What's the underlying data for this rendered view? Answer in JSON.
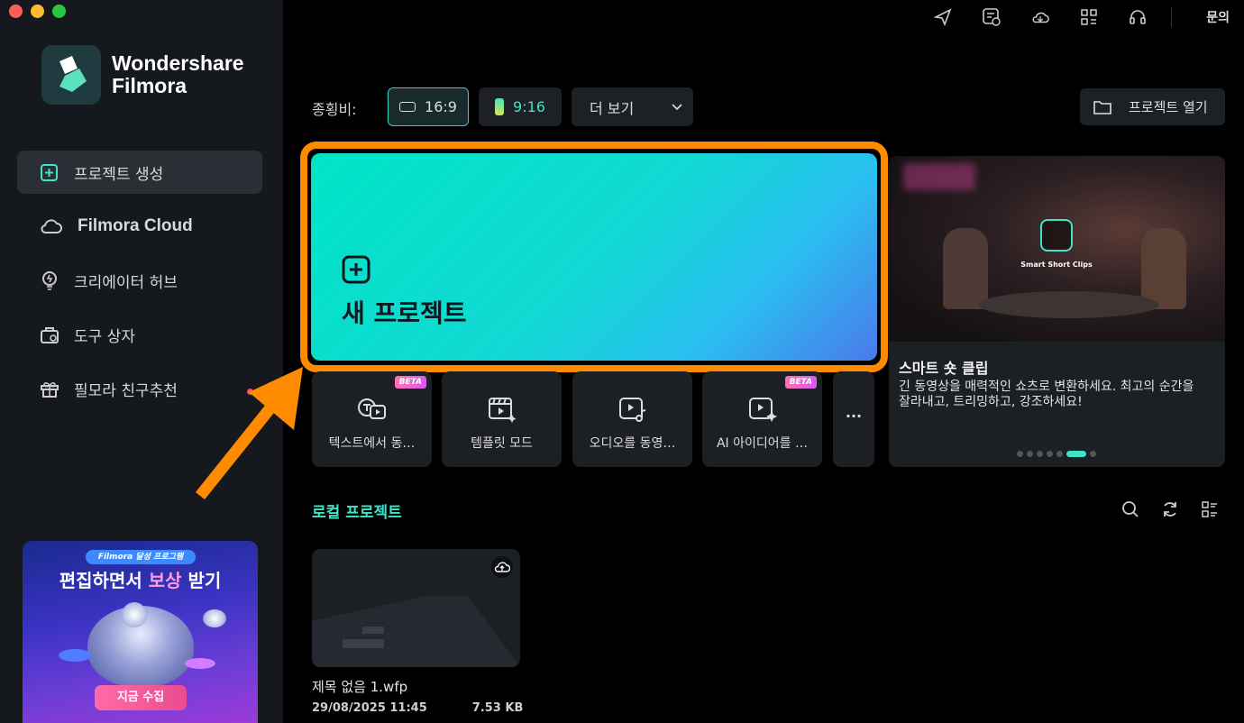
{
  "app": {
    "brand_line1": "Wondershare",
    "brand_line2": "Filmora"
  },
  "colors": {
    "accent": "#3fe3c9",
    "highlight_arrow": "#ff8c00",
    "bg": "#000000",
    "sidebar": "#15181c"
  },
  "sidebar": {
    "items": [
      {
        "label": "프로젝트 생성",
        "icon": "new-project-icon",
        "active": true
      },
      {
        "label": "Filmora Cloud",
        "icon": "cloud-icon"
      },
      {
        "label": "크리에이터 허브",
        "icon": "lightbulb-icon"
      },
      {
        "label": "도구 상자",
        "icon": "toolbox-icon"
      },
      {
        "label": "필모라 친구추천",
        "icon": "gift-icon",
        "badge_dot": true
      }
    ],
    "promo": {
      "tag": "Filmora 달성 프로그램",
      "title_before": "편집하면서 ",
      "title_highlight": "보상",
      "title_after": " 받기",
      "button": "지금 수집"
    }
  },
  "topbar": {
    "icons": [
      "send-icon",
      "schedule-icon",
      "cloud-sync-icon",
      "grid-icon",
      "headset-icon"
    ],
    "help_label": "문의"
  },
  "aspect": {
    "label": "종횡비:",
    "options": [
      {
        "label": "16:9",
        "selected": true
      },
      {
        "label": "9:16"
      },
      {
        "label": "더 보기"
      }
    ],
    "open_project": "프로젝트 열기"
  },
  "new_project": {
    "label": "새 프로젝트"
  },
  "tools": [
    {
      "label": "텍스트에서 동…",
      "beta": "BETA",
      "icon": "text-to-video-icon"
    },
    {
      "label": "템플릿 모드",
      "icon": "template-icon"
    },
    {
      "label": "오디오를 동영…",
      "icon": "audio-to-video-icon"
    },
    {
      "label": "AI 아이디어를 …",
      "beta": "BETA",
      "icon": "ai-idea-icon"
    },
    {
      "label": "···",
      "icon": "more-icon"
    }
  ],
  "carousel": {
    "overlay_label": "Smart Short Clips",
    "title": "스마트 숏 클립",
    "description": "긴 동영상을 매력적인 쇼츠로 변환하세요. 최고의 순간을 잘라내고, 트리밍하고, 강조하세요!",
    "active_dot": 5,
    "dot_count": 7
  },
  "local": {
    "title": "로컬 프로젝트",
    "projects": [
      {
        "name": "제목 없음 1.wfp",
        "date": "29/08/2025 11:45",
        "size": "7.53 KB"
      }
    ]
  }
}
